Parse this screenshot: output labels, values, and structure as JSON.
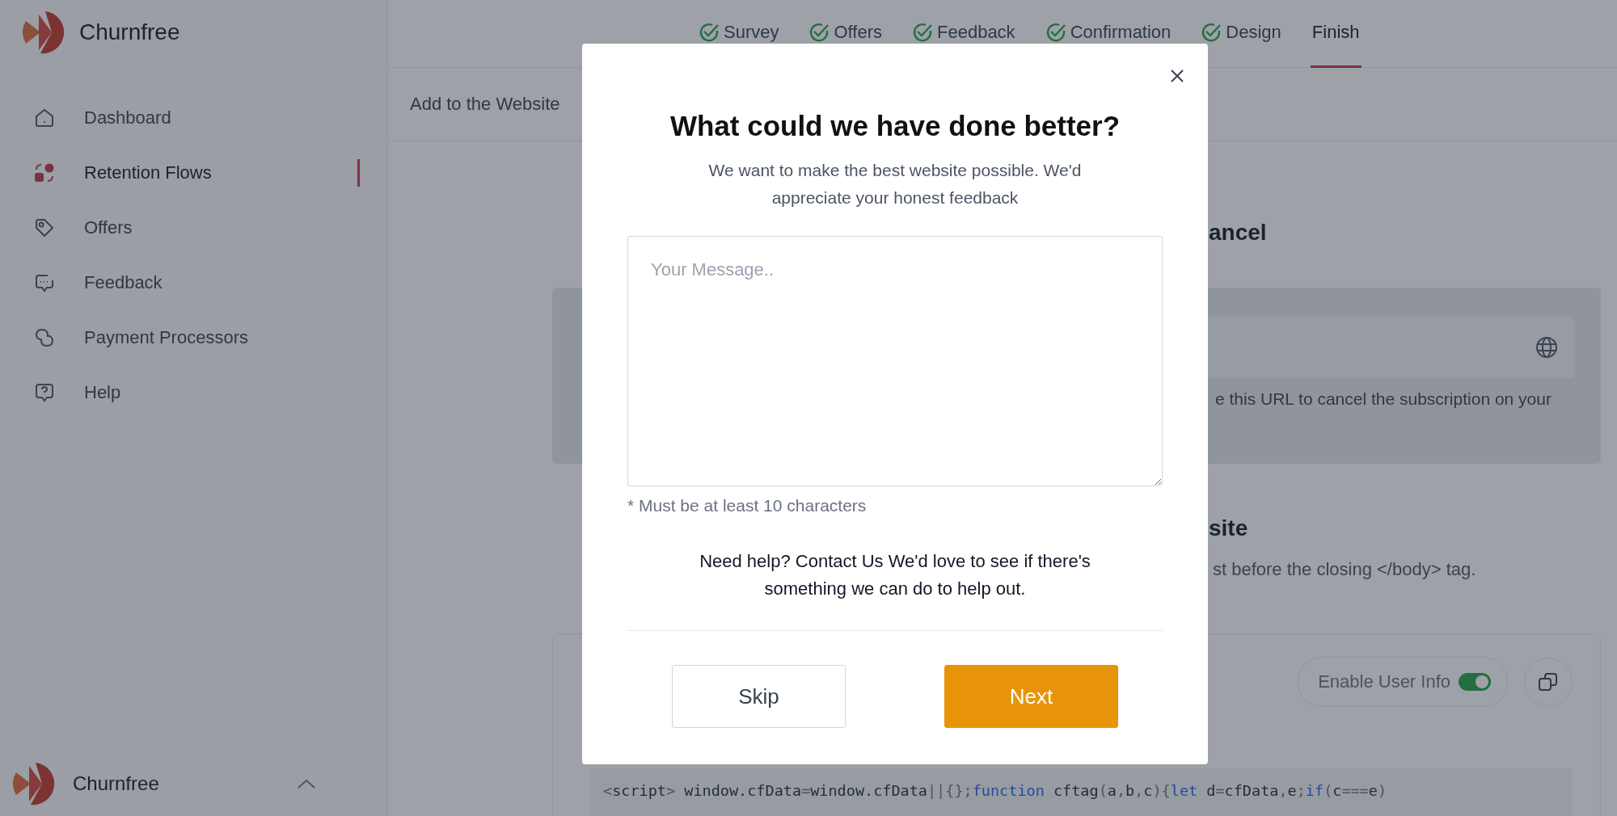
{
  "sidebar": {
    "brand": "Churnfree",
    "items": [
      {
        "label": "Dashboard",
        "selected": false
      },
      {
        "label": "Retention Flows",
        "selected": true
      },
      {
        "label": "Offers",
        "selected": false
      },
      {
        "label": "Feedback",
        "selected": false
      },
      {
        "label": "Payment Processors",
        "selected": false
      },
      {
        "label": "Help",
        "selected": false
      }
    ],
    "footer": {
      "brand": "Churnfree"
    }
  },
  "steps": [
    {
      "label": "Survey",
      "done": true,
      "selected": false
    },
    {
      "label": "Offers",
      "done": true,
      "selected": false
    },
    {
      "label": "Feedback",
      "done": true,
      "selected": false
    },
    {
      "label": "Confirmation",
      "done": true,
      "selected": false
    },
    {
      "label": "Design",
      "done": true,
      "selected": false
    },
    {
      "label": "Finish",
      "done": false,
      "selected": true
    }
  ],
  "subheader": {
    "title": "Add to the Website"
  },
  "section_1": {
    "heading": "ancel",
    "description": "e this URL to cancel the subscription on your"
  },
  "section_2": {
    "heading": "site",
    "description": "st before the closing </body> tag.",
    "toggle": {
      "label": "Enable User Info",
      "on": true
    },
    "code": [
      "<script> window.cfData=window.cfData||{};function cftag(a,b,c){let d=cfData,e;if(c===e)"
    ]
  },
  "modal": {
    "title": "What could we have done better?",
    "subtitle": "We want to make the best website possible. We'd appreciate your honest feedback",
    "message": {
      "placeholder": "Your Message.."
    },
    "hint": "* Must be at least 10 characters",
    "help": "Need help? Contact Us We'd love to see if there's something we can do to help out.",
    "buttons": [
      {
        "label": "Skip",
        "kind": "secondary"
      },
      {
        "label": "Next",
        "kind": "primary"
      }
    ]
  }
}
